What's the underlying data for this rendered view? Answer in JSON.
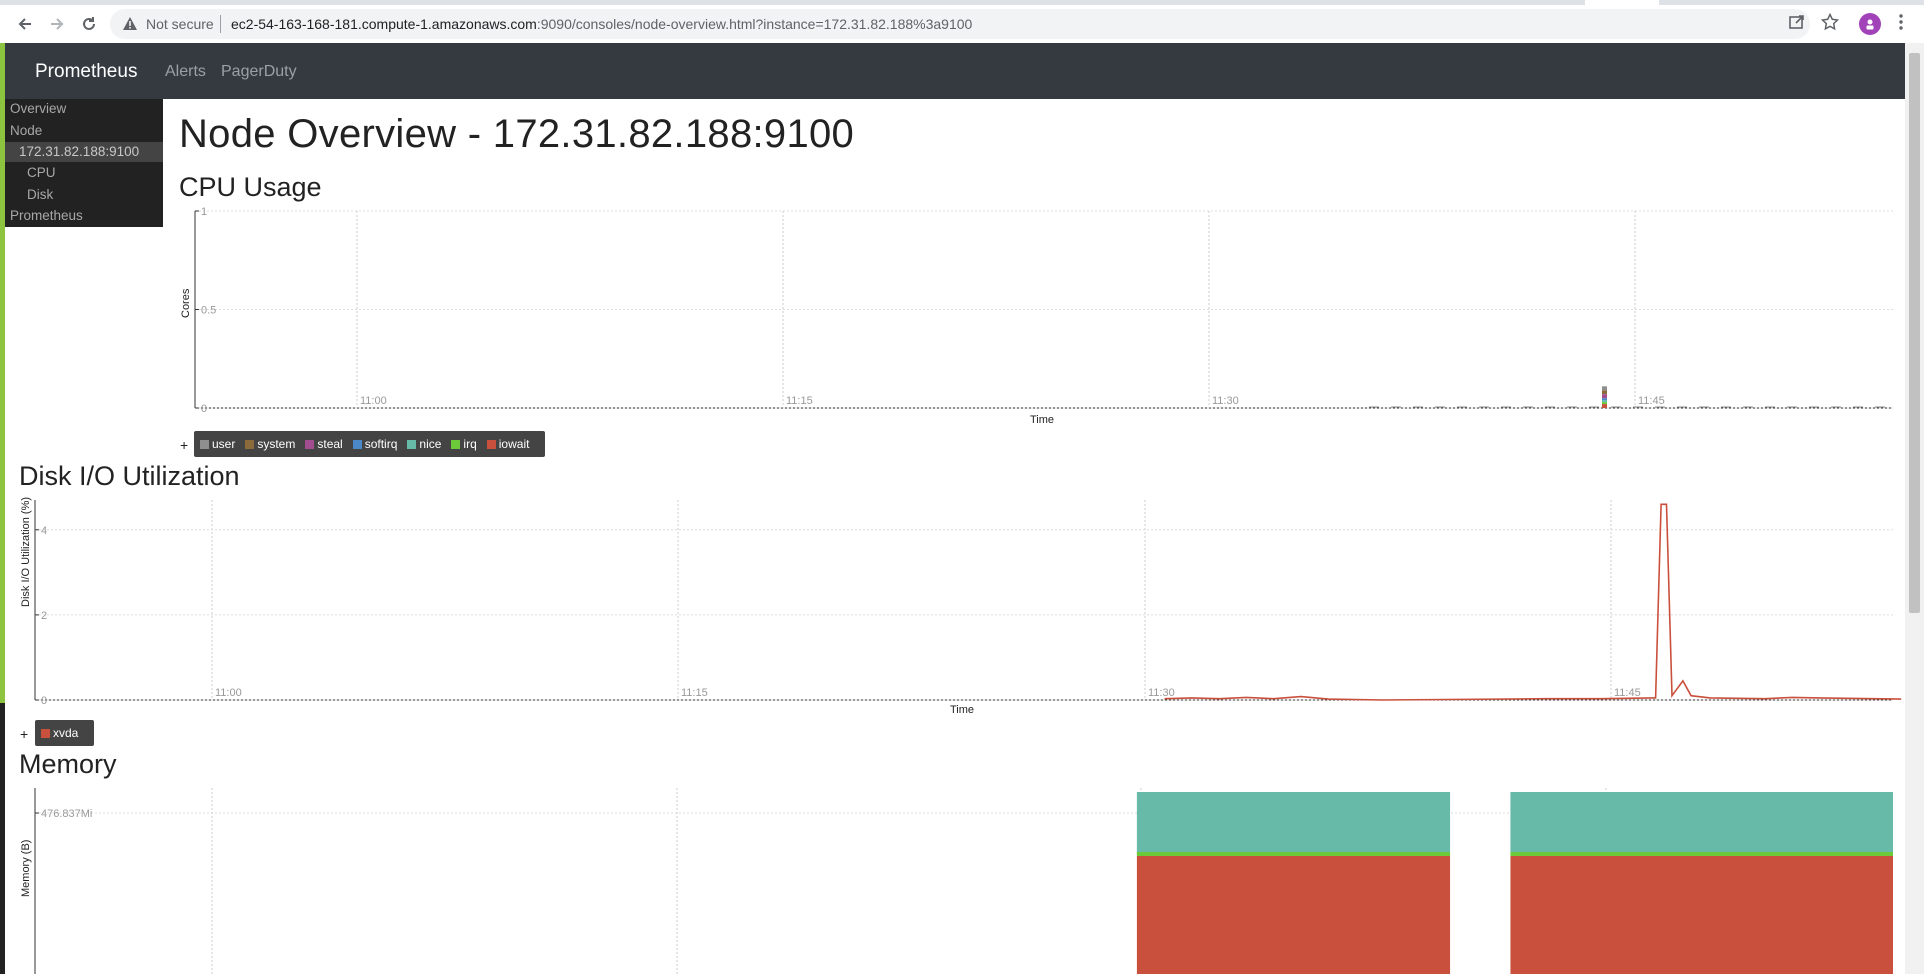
{
  "browser": {
    "security_label": "Not secure",
    "url_host": "ec2-54-163-168-181.compute-1.amazonaws.com",
    "url_rest": ":9090/consoles/node-overview.html?instance=172.31.82.188%3a9100"
  },
  "navbar": {
    "brand": "Prometheus",
    "links": [
      "Alerts",
      "PagerDuty"
    ]
  },
  "sidebar": {
    "items": [
      "Overview",
      "Node",
      "172.31.82.188:9100",
      "CPU",
      "Disk",
      "Prometheus"
    ]
  },
  "page": {
    "title": "Node Overview - 172.31.82.188:9100"
  },
  "sections": {
    "cpu": "CPU Usage",
    "disk": "Disk I/O Utilization",
    "memory": "Memory"
  },
  "legend_expand": "+",
  "colors": {
    "user": "#8f8f8f",
    "system": "#8b6b3c",
    "steal": "#a14d8f",
    "softirq": "#4a88c7",
    "nice": "#67b9a8",
    "irq": "#6cc93a",
    "iowait": "#c9503c",
    "xvda": "#c9503c"
  },
  "chart_data": [
    {
      "type": "line",
      "ylabel": "Cores",
      "xlabel": "Time",
      "x_ticks": [
        "11:00",
        "11:15",
        "11:30",
        "11:45"
      ],
      "y_ticks": [
        "1",
        "0.5",
        "0"
      ],
      "ylim": [
        0,
        1
      ],
      "series": [
        {
          "name": "user"
        },
        {
          "name": "system"
        },
        {
          "name": "steal"
        },
        {
          "name": "softirq"
        },
        {
          "name": "nice"
        },
        {
          "name": "irq"
        },
        {
          "name": "iowait"
        }
      ],
      "stacked_spike": {
        "time": "11:44",
        "user": 0.02,
        "system": 0.02,
        "steal": 0.02,
        "softirq": 0.01,
        "nice": 0.01,
        "irq": 0.01,
        "iowait": 0.02
      }
    },
    {
      "type": "line",
      "ylabel": "Disk I/O Utilization (%)",
      "xlabel": "Time",
      "x_ticks": [
        "11:00",
        "11:15",
        "11:30",
        "11:45"
      ],
      "y_ticks": [
        "4",
        "2",
        "0"
      ],
      "ylim": [
        0,
        4.7
      ],
      "series": [
        {
          "name": "xvda",
          "points": [
            [
              36.0,
              0.03
            ],
            [
              37.0,
              0.05
            ],
            [
              38.0,
              0.03
            ],
            [
              39.0,
              0.06
            ],
            [
              40.0,
              0.03
            ],
            [
              41.0,
              0.08
            ],
            [
              42.0,
              0.02
            ],
            [
              44.0,
              0.0
            ],
            [
              50.0,
              0.03
            ],
            [
              52.0,
              0.03
            ],
            [
              54.0,
              0.05
            ],
            [
              54.2,
              4.6
            ],
            [
              54.4,
              4.6
            ],
            [
              54.6,
              0.1
            ],
            [
              55.0,
              0.45
            ],
            [
              55.3,
              0.1
            ],
            [
              56.0,
              0.05
            ],
            [
              57.0,
              0.04
            ],
            [
              58.0,
              0.03
            ],
            [
              59.0,
              0.06
            ],
            [
              60.0,
              0.05
            ],
            [
              61.0,
              0.04
            ],
            [
              62.0,
              0.03
            ],
            [
              63.0,
              0.02
            ]
          ]
        }
      ]
    },
    {
      "type": "area",
      "ylabel": "Memory (B)",
      "x_ticks": [],
      "y_ticks": [
        "476.837Mi"
      ],
      "stacked": true,
      "segments": [
        {
          "start_min": 35.0,
          "end_min": 46.4
        },
        {
          "start_min": 49.0,
          "end_min": 63.0
        }
      ]
    }
  ]
}
